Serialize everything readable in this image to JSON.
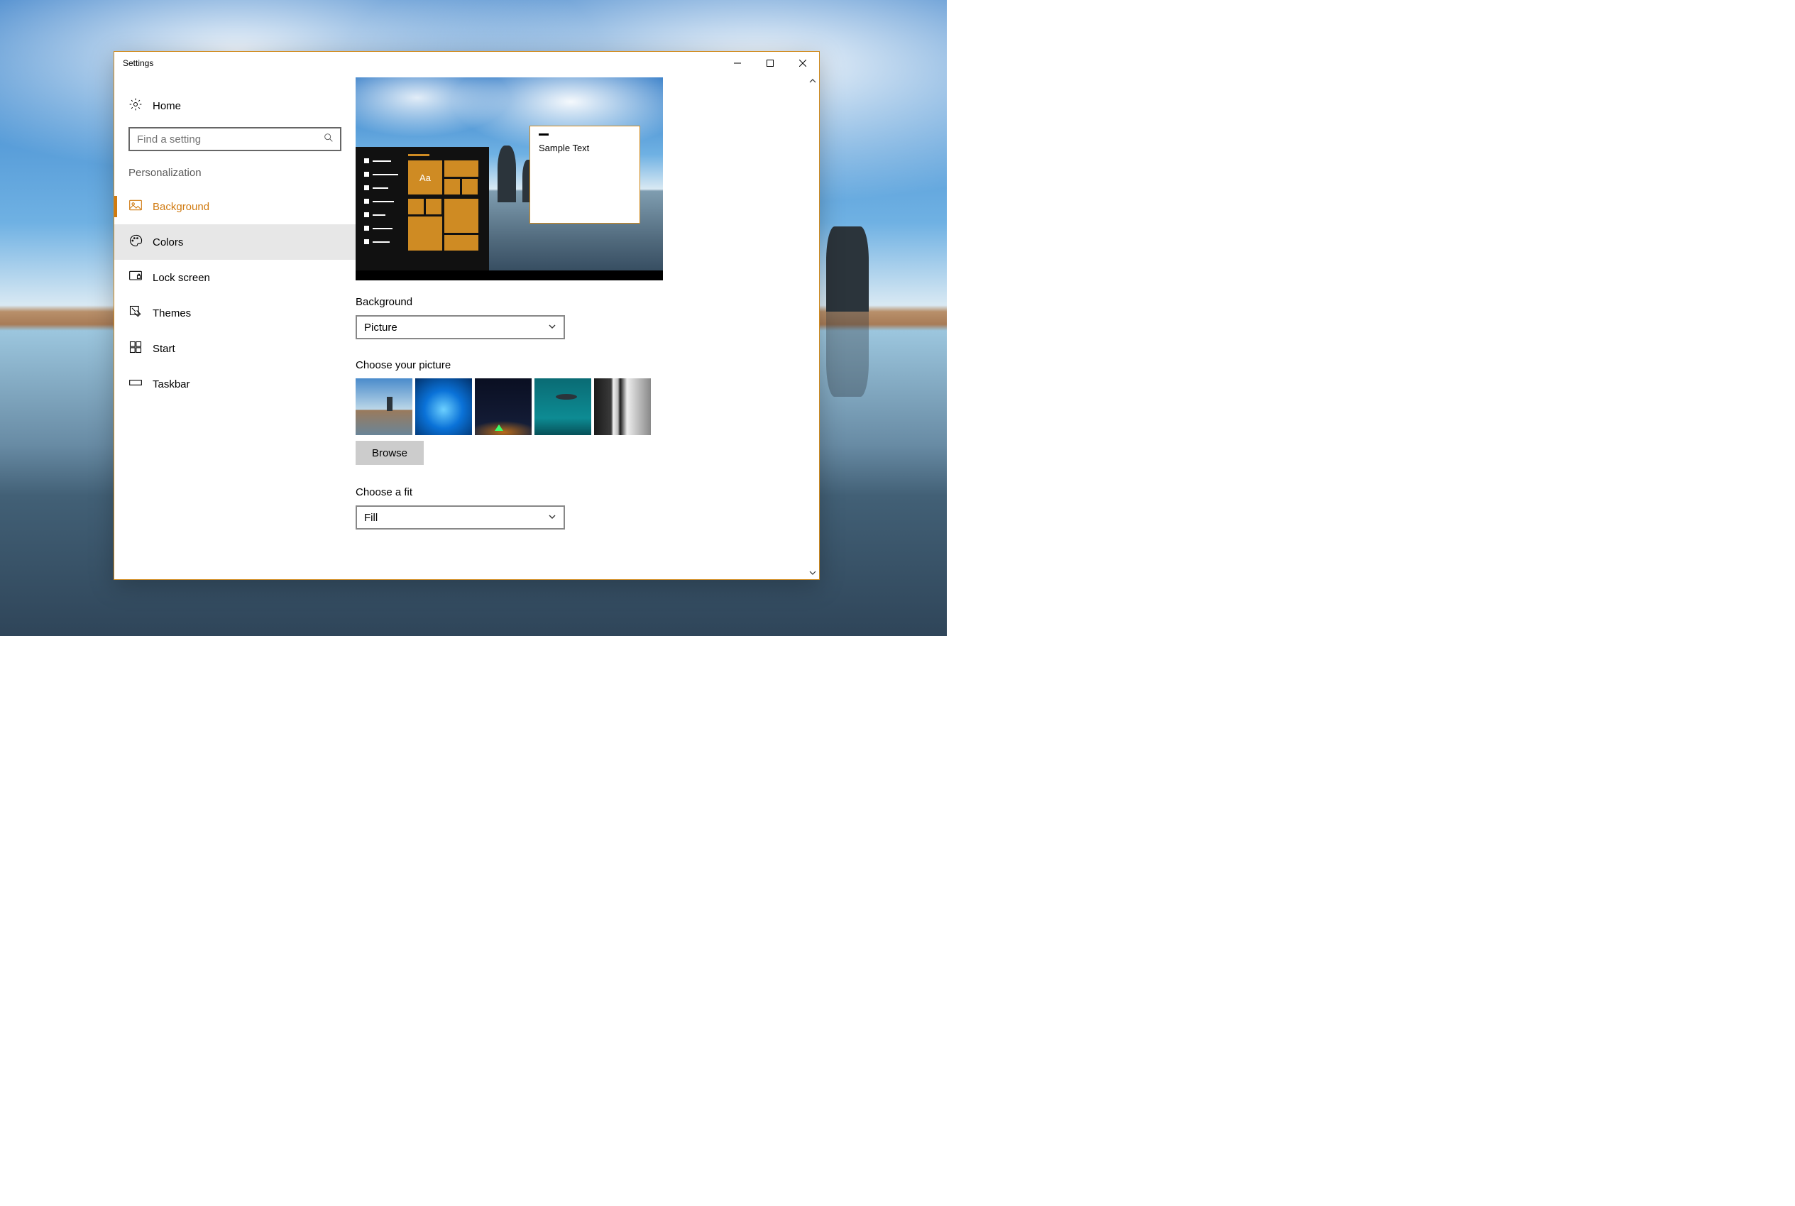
{
  "window": {
    "title": "Settings"
  },
  "sidebar": {
    "home": "Home",
    "search_placeholder": "Find a setting",
    "section": "Personalization",
    "items": [
      {
        "label": "Background"
      },
      {
        "label": "Colors"
      },
      {
        "label": "Lock screen"
      },
      {
        "label": "Themes"
      },
      {
        "label": "Start"
      },
      {
        "label": "Taskbar"
      }
    ]
  },
  "preview": {
    "sample_text": "Sample Text",
    "tile_glyph": "Aa"
  },
  "background": {
    "label": "Background",
    "value": "Picture"
  },
  "choose_picture": {
    "label": "Choose your picture",
    "browse": "Browse"
  },
  "choose_fit": {
    "label": "Choose a fit",
    "value": "Fill"
  }
}
